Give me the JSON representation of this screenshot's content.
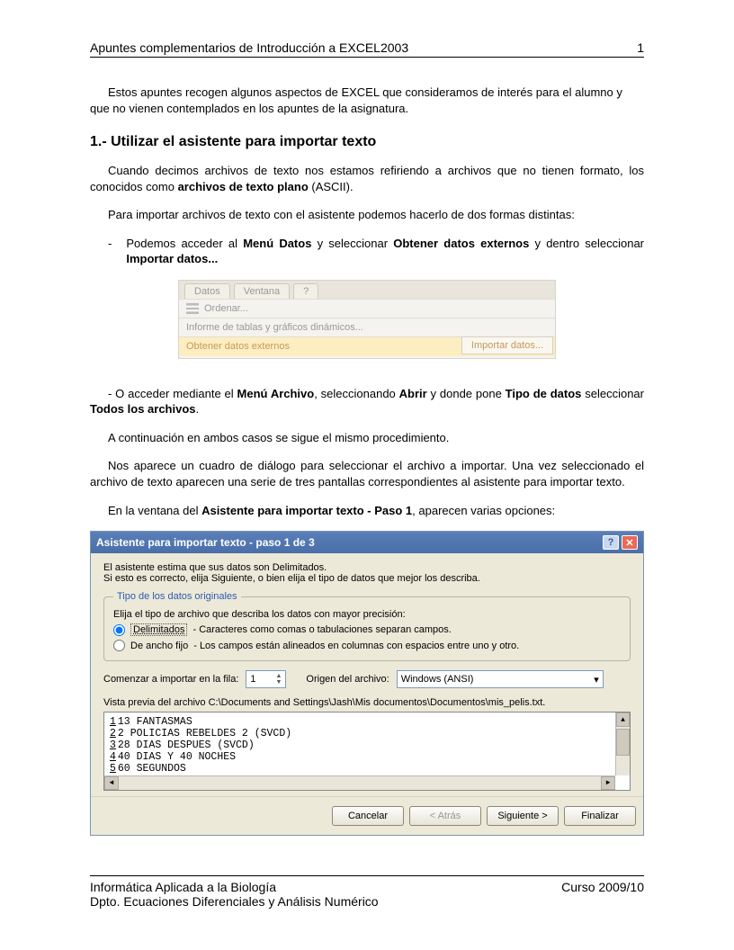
{
  "header": {
    "title": "Apuntes complementarios de Introducción a EXCEL2003",
    "page": "1"
  },
  "intro": "Estos apuntes recogen algunos aspectos de EXCEL que consideramos de interés para el alumno y que no vienen contemplados  en los apuntes de la asignatura.",
  "section_heading": "1.- Utilizar el asistente para importar texto",
  "p1_a": "Cuando decimos archivos de texto nos estamos refiriendo a archivos que no tienen formato, los conocidos como ",
  "p1_bold": "archivos de texto plano",
  "p1_b": " (ASCII).",
  "p2": "Para importar archivos de texto con el asistente podemos hacerlo de dos formas distintas:",
  "bullet": {
    "t1": "Podemos acceder al ",
    "b1": "Menú Datos",
    "t2": " y seleccionar ",
    "b2": "Obtener datos externos",
    "t3": " y dentro seleccionar ",
    "b3": "Importar datos..."
  },
  "menu": {
    "tab_datos": "Datos",
    "tab_ventana": "Ventana",
    "tab_q": "?",
    "row_ordenar": "Ordenar...",
    "row_informe": "Informe de tablas y gráficos dinámicos...",
    "row_obtener": "Obtener datos externos",
    "submenu_importar": "Importar datos..."
  },
  "p3": {
    "t1": "- O acceder mediante el ",
    "b1": "Menú Archivo",
    "t2": ", seleccionando ",
    "b2": "Abrir",
    "t3": " y donde pone ",
    "b3": "Tipo de datos",
    "t4": " seleccionar ",
    "b4": "Todos los archivos",
    "t5": "."
  },
  "p4": "A continuación en ambos casos se sigue el mismo procedimiento.",
  "p5": "Nos aparece un cuadro de diálogo para seleccionar el archivo a importar. Una vez seleccionado el archivo de texto aparecen una serie de tres pantallas correspondientes al asistente para importar texto.",
  "p6_a": "En la ventana del ",
  "p6_b": "Asistente para importar texto - Paso 1",
  "p6_c": ", aparecen varias opciones:",
  "wizard": {
    "title": "Asistente para importar texto - paso 1 de 3",
    "line1": "El asistente estima que sus datos son Delimitados.",
    "line2": "Si esto es correcto, elija Siguiente, o bien elija el tipo de datos que mejor los describa.",
    "fieldset_legend": "Tipo de los datos originales",
    "fieldset_prompt": "Elija el tipo de archivo que describa los datos con mayor precisión:",
    "radio1_label": "Delimitados",
    "radio1_desc": "- Caracteres como comas o tabulaciones separan campos.",
    "radio2_label": "De ancho fijo",
    "radio2_desc": "- Los campos están alineados en columnas con espacios entre uno y otro.",
    "start_label": "Comenzar a importar en la fila:",
    "start_value": "1",
    "origin_label": "Origen del archivo:",
    "origin_value": "Windows (ANSI)",
    "preview_label": "Vista previa del archivo C:\\Documents and Settings\\Jash\\Mis documentos\\Documentos\\mis_pelis.txt.",
    "preview_lines": [
      {
        "n": "1",
        "t": "13 FANTASMAS"
      },
      {
        "n": "2",
        "t": "2 POLICIAS REBELDES 2 (SVCD)"
      },
      {
        "n": "3",
        "t": "28 DIAS DESPUES (SVCD)"
      },
      {
        "n": "4",
        "t": "40 DIAS Y 40 NOCHES"
      },
      {
        "n": "5",
        "t": "60 SEGUNDOS"
      }
    ],
    "btn_cancel": "Cancelar",
    "btn_back": "< Atrás",
    "btn_next": "Siguiente >",
    "btn_finish": "Finalizar"
  },
  "footer": {
    "left1": "Informática Aplicada a la Biología",
    "right1": "Curso 2009/10",
    "left2": "Dpto. Ecuaciones Diferenciales y Análisis Numérico"
  }
}
